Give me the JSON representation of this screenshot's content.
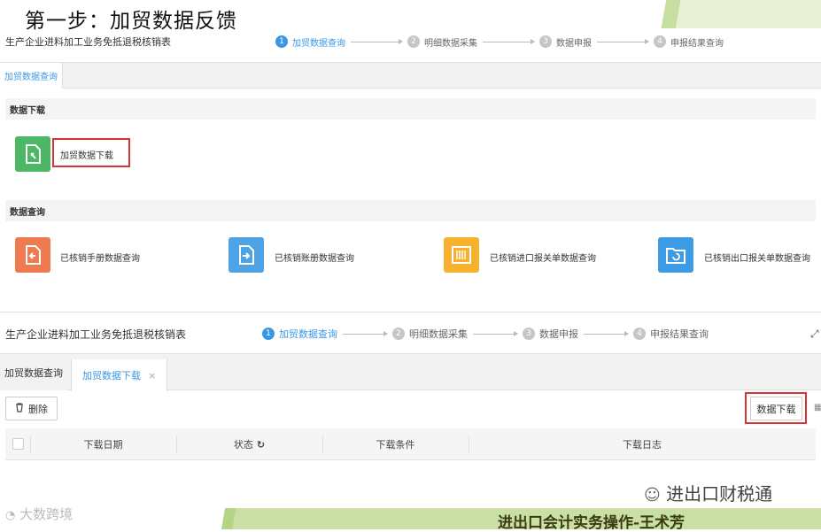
{
  "slide": {
    "title": "第一步：加贸数据反馈",
    "footer": "进出口会计实务操作-王术芳"
  },
  "watermarks": {
    "wechat": "进出口财税通",
    "brand": "大数跨境"
  },
  "panel1": {
    "app_title": "生产企业进料加工业务免抵退税核销表",
    "steps": [
      {
        "num": "1",
        "label": "加贸数据查询",
        "active": true
      },
      {
        "num": "2",
        "label": "明细数据采集",
        "active": false
      },
      {
        "num": "3",
        "label": "数据申报",
        "active": false
      },
      {
        "num": "4",
        "label": "申报结果查询",
        "active": false
      }
    ],
    "tab": "加贸数据查询",
    "download_section": "数据下载",
    "download_tile": {
      "label": "加贸数据下载",
      "icon": "document-download-icon",
      "color": "#4cb865"
    },
    "query_section": "数据查询",
    "query_tiles": [
      {
        "label": "已核销手册数据查询",
        "icon": "document-return-icon",
        "color": "#f07a50"
      },
      {
        "label": "已核销账册数据查询",
        "icon": "document-arrow-icon",
        "color": "#4ea3e6"
      },
      {
        "label": "已核销进口报关单数据查询",
        "icon": "barcode-icon",
        "color": "#f6b12e"
      },
      {
        "label": "已核销出口报关单数据查询",
        "icon": "folder-refresh-icon",
        "color": "#3d9be3"
      }
    ]
  },
  "panel2": {
    "app_title": "生产企业进料加工业务免抵退税核销表",
    "steps": [
      {
        "num": "1",
        "label": "加贸数据查询",
        "active": true
      },
      {
        "num": "2",
        "label": "明细数据采集",
        "active": false
      },
      {
        "num": "3",
        "label": "数据申报",
        "active": false
      },
      {
        "num": "4",
        "label": "申报结果查询",
        "active": false
      }
    ],
    "tabs": [
      {
        "label": "加贸数据查询",
        "active": false
      },
      {
        "label": "加贸数据下载",
        "active": true,
        "close": "×"
      }
    ],
    "delete_button": "删除",
    "download_button": "数据下载",
    "table_headers": [
      "下载日期",
      "状态",
      "下载条件",
      "下载日志"
    ]
  },
  "colors": {
    "accent": "#3a97e6",
    "highlight": "#d6323a"
  }
}
